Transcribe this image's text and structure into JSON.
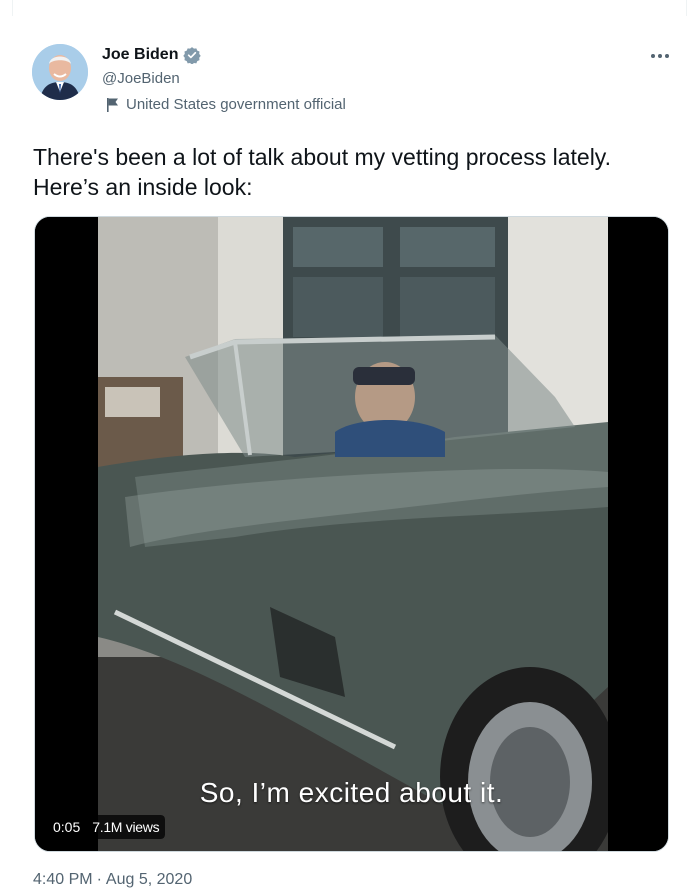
{
  "author": {
    "display_name": "Joe Biden",
    "handle": "@JoeBiden",
    "affiliation_label": "United States government official",
    "verified": true
  },
  "tweet": {
    "text": "There's been a lot of talk about my vetting process lately. Here’s an inside look:",
    "time": "4:40 PM",
    "separator": "·",
    "date": "Aug 5, 2020"
  },
  "video": {
    "caption": "So, I’m excited about it.",
    "elapsed": "0:05",
    "views": "7.1M views"
  },
  "colors": {
    "text_primary": "#0f1419",
    "text_secondary": "#536471",
    "verified_badge": "#829aab",
    "border": "#cfd9de"
  },
  "icons": {
    "verified": "verified-badge-icon",
    "affiliation": "flag-icon",
    "more": "more-dots-icon"
  }
}
